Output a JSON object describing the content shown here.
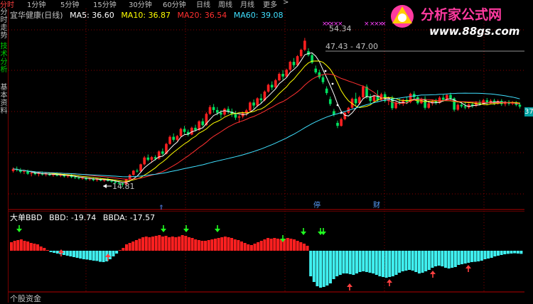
{
  "tabs": [
    "分时",
    "1分钟",
    "5分钟",
    "15分钟",
    "30分钟",
    "60分钟",
    "日线",
    "周线",
    "月线",
    "更多",
    ">"
  ],
  "sidebar": [
    "分时走势",
    "技术分析",
    "基本资料"
  ],
  "stock_title": "宜华健康(日线)",
  "ma": [
    {
      "label": "MA5: 36.60",
      "color": "#ffffff"
    },
    {
      "label": "MA10: 36.87",
      "color": "#ffff00"
    },
    {
      "label": "MA20: 36.54",
      "color": "#ff3030"
    },
    {
      "label": "MA60: 39.08",
      "color": "#40e0ff"
    }
  ],
  "annotations": {
    "high": "54.34",
    "range": "47.43 - 47.00",
    "low": "14.81"
  },
  "markers": {
    "marker1": "停",
    "marker2": "财"
  },
  "right_tag": "37",
  "indicator": {
    "name": "大单BBD",
    "bbd": "BBD: -19.74",
    "bbda": "BBDA: -17.57"
  },
  "bottom_label": "个股资金",
  "logo": {
    "title": "分析家公式网",
    "url": "www.88gs.com"
  },
  "chart_data": [
    {
      "type": "candlestick",
      "title": "宜华健康(日线)",
      "ylim": [
        12,
        58
      ],
      "candles": [
        [
          19,
          20,
          18.6,
          19.6
        ],
        [
          19.6,
          20.2,
          18.9,
          19.3
        ],
        [
          19.3,
          19.8,
          18.4,
          18.8
        ],
        [
          18.8,
          19.4,
          18.2,
          19.0
        ],
        [
          19.0,
          19.4,
          18.0,
          18.3
        ],
        [
          18.3,
          18.9,
          17.6,
          18.5
        ],
        [
          18.5,
          19.0,
          17.9,
          18.2
        ],
        [
          18.2,
          18.8,
          17.6,
          18.4
        ],
        [
          18.4,
          18.9,
          17.8,
          18.1
        ],
        [
          18.1,
          18.7,
          17.6,
          18.3
        ],
        [
          18.3,
          18.6,
          17.7,
          17.9
        ],
        [
          17.9,
          18.5,
          17.5,
          18.2
        ],
        [
          18.2,
          18.7,
          17.6,
          17.8
        ],
        [
          17.8,
          18.3,
          17.4,
          18.0
        ],
        [
          18.0,
          18.4,
          17.3,
          17.6
        ],
        [
          17.6,
          18.1,
          17.2,
          17.9
        ],
        [
          17.9,
          18.2,
          17.1,
          17.4
        ],
        [
          17.4,
          17.8,
          16.9,
          17.2
        ],
        [
          17.2,
          17.6,
          16.8,
          17.0
        ],
        [
          17.0,
          17.4,
          16.7,
          17.2
        ],
        [
          17.2,
          17.5,
          16.5,
          16.8
        ],
        [
          16.8,
          17.2,
          16.4,
          17.0
        ],
        [
          17.0,
          17.3,
          16.3,
          16.6
        ],
        [
          16.6,
          17.0,
          16.2,
          16.9
        ],
        [
          16.9,
          17.2,
          16.3,
          16.5
        ],
        [
          16.5,
          17.0,
          16.1,
          16.8
        ],
        [
          16.8,
          17.2,
          16.2,
          16.4
        ],
        [
          16.4,
          16.8,
          15.9,
          16.2
        ],
        [
          16.2,
          16.6,
          15.6,
          15.9
        ],
        [
          15.9,
          16.3,
          15.4,
          15.7
        ],
        [
          15.7,
          16.0,
          14.8,
          15.4
        ],
        [
          15.4,
          17.0,
          15.2,
          16.8
        ],
        [
          16.8,
          18.2,
          16.6,
          18.0
        ],
        [
          18.0,
          19.3,
          17.8,
          19.1
        ],
        [
          19.1,
          19.6,
          18.6,
          18.9
        ],
        [
          18.9,
          21.0,
          18.7,
          20.8
        ],
        [
          20.8,
          23.0,
          20.5,
          22.6
        ],
        [
          22.6,
          23.4,
          21.6,
          22.0
        ],
        [
          22.0,
          23.0,
          21.2,
          22.7
        ],
        [
          22.7,
          23.2,
          21.8,
          22.3
        ],
        [
          22.3,
          24.5,
          22.0,
          24.2
        ],
        [
          24.2,
          25.0,
          23.2,
          23.6
        ],
        [
          23.6,
          26.5,
          23.4,
          26.2
        ],
        [
          26.2,
          28.5,
          26.0,
          28.1
        ],
        [
          28.1,
          29.0,
          26.8,
          27.3
        ],
        [
          27.3,
          28.6,
          26.9,
          28.3
        ],
        [
          28.3,
          30.5,
          28.0,
          30.2
        ],
        [
          30.2,
          31.0,
          28.8,
          29.4
        ],
        [
          29.4,
          30.0,
          28.2,
          28.7
        ],
        [
          28.7,
          30.8,
          28.5,
          30.5
        ],
        [
          30.5,
          31.3,
          29.5,
          29.9
        ],
        [
          29.9,
          32.5,
          29.6,
          32.2
        ],
        [
          32.2,
          33.0,
          30.8,
          31.2
        ],
        [
          31.2,
          34.6,
          31.0,
          34.2
        ],
        [
          34.2,
          36.5,
          33.9,
          36.0
        ],
        [
          36.0,
          36.8,
          34.5,
          35.2
        ],
        [
          35.2,
          36.0,
          33.8,
          34.5
        ],
        [
          34.5,
          35.2,
          33.0,
          34.0
        ],
        [
          34.0,
          35.8,
          33.6,
          35.5
        ],
        [
          35.5,
          36.2,
          34.2,
          34.8
        ],
        [
          34.8,
          35.6,
          33.4,
          34.1
        ],
        [
          34.1,
          35.0,
          32.6,
          33.2
        ],
        [
          33.2,
          34.0,
          31.8,
          33.5
        ],
        [
          33.5,
          34.8,
          33.0,
          34.4
        ],
        [
          34.4,
          35.5,
          33.6,
          35.1
        ],
        [
          35.1,
          37.5,
          34.8,
          37.2
        ],
        [
          37.2,
          38.0,
          35.5,
          36.4
        ],
        [
          36.4,
          38.6,
          36.0,
          38.3
        ],
        [
          38.3,
          39.5,
          37.0,
          37.8
        ],
        [
          37.8,
          40.4,
          37.5,
          40.1
        ],
        [
          40.1,
          42.2,
          39.8,
          41.9
        ],
        [
          41.9,
          42.8,
          40.5,
          41.2
        ],
        [
          41.2,
          43.5,
          40.8,
          43.1
        ],
        [
          43.1,
          45.2,
          42.8,
          44.8
        ],
        [
          44.8,
          45.8,
          43.2,
          44.1
        ],
        [
          44.1,
          46.2,
          43.8,
          45.9
        ],
        [
          45.9,
          48.3,
          45.5,
          48.0
        ],
        [
          48.0,
          49.0,
          46.4,
          47.1
        ],
        [
          47.1,
          49.8,
          46.8,
          49.5
        ],
        [
          49.5,
          51.5,
          49.0,
          51.2
        ],
        [
          51.2,
          54.34,
          50.8,
          53.6
        ],
        [
          50.8,
          51.6,
          49.4,
          49.8
        ],
        [
          49.8,
          50.2,
          47.43,
          47.8
        ],
        [
          46.2,
          47.0,
          44.8,
          45.2
        ],
        [
          45.2,
          45.9,
          43.4,
          43.9
        ],
        [
          43.9,
          44.5,
          42.1,
          42.6
        ],
        [
          40.9,
          41.5,
          39.2,
          39.7
        ],
        [
          38.1,
          38.8,
          36.3,
          36.8
        ],
        [
          34.9,
          35.5,
          33.5,
          34.0
        ],
        [
          31.8,
          32.4,
          30.4,
          31.0
        ],
        [
          31.0,
          33.2,
          30.8,
          32.8
        ],
        [
          32.8,
          34.8,
          32.5,
          34.5
        ],
        [
          34.5,
          36.0,
          34.2,
          35.8
        ],
        [
          35.8,
          38.5,
          35.6,
          38.2
        ],
        [
          38.2,
          39.8,
          36.4,
          37.0
        ],
        [
          37.0,
          39.0,
          36.6,
          38.6
        ],
        [
          38.6,
          41.8,
          38.3,
          41.4
        ],
        [
          41.4,
          42.0,
          38.2,
          38.7
        ],
        [
          38.7,
          39.5,
          37.0,
          37.6
        ],
        [
          37.6,
          39.3,
          37.2,
          38.9
        ],
        [
          38.9,
          40.5,
          37.4,
          37.8
        ],
        [
          37.8,
          39.8,
          37.5,
          39.4
        ],
        [
          39.4,
          40.0,
          37.2,
          37.6
        ],
        [
          37.6,
          38.8,
          36.5,
          38.4
        ],
        [
          38.4,
          39.0,
          35.2,
          35.7
        ],
        [
          35.7,
          37.6,
          35.4,
          37.2
        ],
        [
          37.2,
          38.4,
          36.5,
          37.0
        ],
        [
          37.0,
          38.2,
          36.3,
          37.9
        ],
        [
          37.9,
          38.6,
          36.8,
          37.3
        ],
        [
          37.3,
          39.8,
          37.0,
          39.5
        ],
        [
          39.5,
          40.2,
          38.2,
          38.6
        ],
        [
          38.6,
          39.0,
          36.6,
          37.0
        ],
        [
          37.0,
          38.5,
          36.8,
          38.2
        ],
        [
          38.2,
          38.9,
          35.3,
          35.8
        ],
        [
          35.8,
          37.3,
          35.5,
          37.0
        ],
        [
          37.0,
          38.0,
          36.4,
          37.6
        ],
        [
          37.6,
          38.2,
          36.6,
          37.1
        ],
        [
          37.1,
          38.9,
          36.8,
          38.5
        ],
        [
          38.5,
          39.3,
          37.4,
          37.9
        ],
        [
          37.9,
          39.5,
          37.6,
          39.2
        ],
        [
          39.2,
          39.8,
          37.8,
          38.3
        ],
        [
          38.3,
          38.6,
          34.8,
          35.3
        ],
        [
          35.3,
          37.0,
          35.0,
          36.6
        ],
        [
          36.6,
          37.4,
          35.8,
          36.2
        ],
        [
          36.2,
          37.3,
          35.4,
          35.9
        ],
        [
          35.9,
          37.0,
          35.5,
          36.7
        ],
        [
          36.7,
          37.4,
          35.8,
          36.3
        ],
        [
          36.3,
          37.6,
          36.0,
          37.2
        ],
        [
          37.2,
          37.9,
          36.4,
          36.8
        ],
        [
          36.8,
          38.2,
          36.6,
          37.8
        ],
        [
          37.8,
          38.4,
          36.6,
          37.0
        ],
        [
          37.0,
          38.1,
          36.7,
          37.7
        ],
        [
          37.7,
          38.2,
          36.5,
          36.9
        ],
        [
          36.9,
          38.0,
          36.6,
          37.6
        ],
        [
          37.6,
          38.1,
          36.3,
          36.8
        ],
        [
          36.8,
          37.6,
          36.2,
          37.3
        ],
        [
          37.3,
          37.8,
          36.4,
          36.9
        ],
        [
          36.9,
          37.6,
          36.5,
          37.2
        ],
        [
          37.2,
          37.6,
          36.2,
          36.6
        ],
        [
          36.6,
          37.2,
          35.6,
          36.1
        ]
      ],
      "ma_series": [
        {
          "name": "MA5",
          "color": "#ffffff"
        },
        {
          "name": "MA10",
          "color": "#ffff00"
        },
        {
          "name": "MA20",
          "color": "#ff3030"
        },
        {
          "name": "MA60",
          "color": "#40e0ff"
        }
      ]
    },
    {
      "type": "bar",
      "title": "大单BBD",
      "series": [
        {
          "name": "BBD",
          "values": [
            0.6,
            0.7,
            0.75,
            0.8,
            0.7,
            0.65,
            0.55,
            0.5,
            0.45,
            0.3,
            0.2,
            0.05,
            -0.1,
            -0.15,
            -0.2,
            -0.25,
            -0.3,
            -0.35,
            -0.4,
            -0.45,
            -0.5,
            -0.55,
            -0.6,
            -0.62,
            -0.66,
            -0.7,
            -0.72,
            -0.78,
            -0.8,
            -0.75,
            -0.6,
            -0.4,
            -0.2,
            0.05,
            0.2,
            0.45,
            0.55,
            0.65,
            0.75,
            0.85,
            0.95,
            1.0,
            0.95,
            1.0,
            1.05,
            1.1,
            1.0,
            1.05,
            0.95,
            1.0,
            0.95,
            1.0,
            1.1,
            1.05,
            0.95,
            0.9,
            0.8,
            0.75,
            0.7,
            0.7,
            0.75,
            0.8,
            0.85,
            0.9,
            0.95,
            1.0,
            0.95,
            0.9,
            0.8,
            0.75,
            0.65,
            0.55,
            0.45,
            0.4,
            0.5,
            0.6,
            0.7,
            0.8,
            0.9,
            0.85,
            0.9,
            0.85,
            0.8,
            0.85,
            0.9,
            0.85,
            0.8,
            0.7,
            0.6,
            0.5,
            0.35,
            -1.8,
            -2.2,
            -2.5,
            -2.6,
            -2.55,
            -2.45,
            -2.3,
            -2.0,
            -1.8,
            -1.7,
            -1.6,
            -1.6,
            -1.65,
            -1.7,
            -1.6,
            -1.5,
            -1.45,
            -1.5,
            -1.55,
            -1.6,
            -1.7,
            -1.8,
            -1.85,
            -1.9,
            -1.85,
            -1.8,
            -1.7,
            -1.55,
            -1.45,
            -1.4,
            -1.35,
            -1.4,
            -1.5,
            -1.6,
            -1.55,
            -1.45,
            -1.35,
            -1.2,
            -1.1,
            -1.05,
            -1.1,
            -1.2,
            -1.25,
            -1.2,
            -1.15,
            -1.0,
            -0.95,
            -0.9,
            -0.85,
            -0.8,
            -0.78,
            -0.75,
            -0.7,
            -0.6,
            -0.55,
            -0.5,
            -0.4,
            -0.35,
            -0.3,
            -0.25,
            -0.22,
            -0.2,
            -0.18,
            -0.2,
            -0.22
          ]
        }
      ]
    }
  ]
}
